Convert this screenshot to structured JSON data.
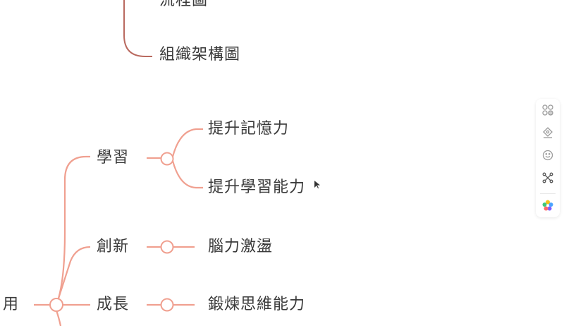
{
  "mindmap": {
    "nodes": {
      "flowchart": "流程圖",
      "org_chart": "組織架構圖",
      "learning": "學習",
      "memory": "提升記憶力",
      "learning_ability": "提升學習能力",
      "innovation": "創新",
      "brainstorm": "腦力激盪",
      "growth": "成長",
      "thinking": "鍛煉思維能力",
      "application_partial": "用"
    },
    "colors": {
      "upper_branch": "#b9695f",
      "lower_branch": "#f0a090",
      "text": "#3a3a3a"
    }
  },
  "toolbar": {
    "items": [
      {
        "icon": "layout-icon"
      },
      {
        "icon": "style-icon"
      },
      {
        "icon": "emoji-icon"
      },
      {
        "icon": "structure-icon"
      },
      {
        "icon": "color-theme-icon"
      }
    ]
  }
}
